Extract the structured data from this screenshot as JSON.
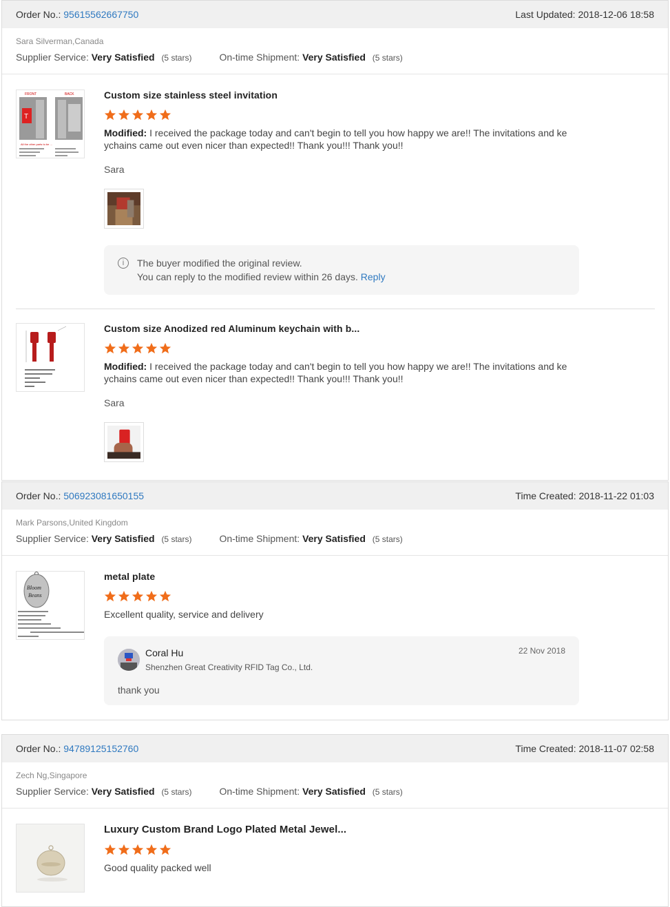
{
  "accent": "#2f79c0",
  "star_color": "#f06d1a",
  "orders": [
    {
      "order_label": "Order No.:",
      "order_no": "95615562667750",
      "time_label": "Last Updated:",
      "time": "2018-12-06 18:58",
      "buyer": "Sara Silverman,Canada",
      "supplier_label": "Supplier Service:",
      "supplier_value": "Very Satisfied",
      "supplier_stars": "(5 stars)",
      "shipment_label": "On-time Shipment:",
      "shipment_value": "Very Satisfied",
      "shipment_stars": "(5 stars)",
      "items": [
        {
          "title": "Custom size stainless steel invitation",
          "rating": 5,
          "modified_label": "Modified:",
          "text": " I received the package today and can't begin to tell you how happy we are!! The invitations and ke ychains came out even nicer than expected!! Thank you!!! Thank you!!",
          "signer": "Sara",
          "notice_line1": "The buyer modified the original review.",
          "notice_line2": "You can reply to the modified review within 26 days.",
          "notice_link": "Reply"
        },
        {
          "title": "Custom size Anodized red Aluminum keychain with b...",
          "rating": 5,
          "modified_label": "Modified:",
          "text": " I received the package today and can't begin to tell you how happy we are!! The invitations and ke ychains came out even nicer than expected!! Thank you!!! Thank you!!",
          "signer": "Sara"
        }
      ]
    },
    {
      "order_label": "Order No.:",
      "order_no": "506923081650155",
      "time_label": "Time Created:",
      "time": "2018-11-22 01:03",
      "buyer": "Mark Parsons,United Kingdom",
      "supplier_label": "Supplier Service:",
      "supplier_value": "Very Satisfied",
      "supplier_stars": "(5 stars)",
      "shipment_label": "On-time Shipment:",
      "shipment_value": "Very Satisfied",
      "shipment_stars": "(5 stars)",
      "items": [
        {
          "title": "metal plate",
          "rating": 5,
          "text": "Excellent quality, service and delivery",
          "reply_name": "Coral Hu",
          "reply_company": "Shenzhen Great Creativity RFID Tag Co., Ltd.",
          "reply_date": "22 Nov 2018",
          "reply_msg": "thank you"
        }
      ]
    },
    {
      "order_label": "Order No.:",
      "order_no": "94789125152760",
      "time_label": "Time Created:",
      "time": "2018-11-07 02:58",
      "buyer": "Zech Ng,Singapore",
      "supplier_label": "Supplier Service:",
      "supplier_value": "Very Satisfied",
      "supplier_stars": "(5 stars)",
      "shipment_label": "On-time Shipment:",
      "shipment_value": "Very Satisfied",
      "shipment_stars": "(5 stars)",
      "items": [
        {
          "title": "Luxury Custom Brand Logo Plated Metal Jewel...",
          "rating": 5,
          "text": "Good quality packed well"
        }
      ]
    }
  ]
}
